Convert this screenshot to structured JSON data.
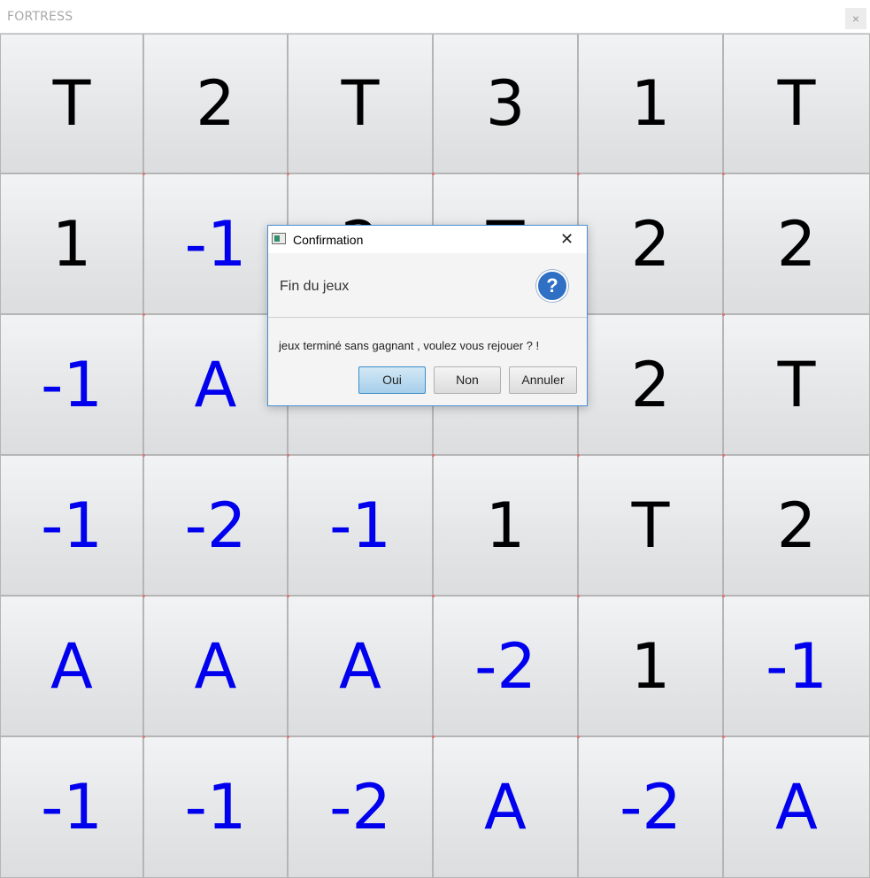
{
  "window": {
    "title": "FORTRESS",
    "close_glyph": "×"
  },
  "board": {
    "rows": [
      [
        {
          "v": "T",
          "team": "enemy"
        },
        {
          "v": "2",
          "team": "enemy"
        },
        {
          "v": "T",
          "team": "enemy"
        },
        {
          "v": "3",
          "team": "enemy"
        },
        {
          "v": "1",
          "team": "enemy"
        },
        {
          "v": "T",
          "team": "enemy"
        }
      ],
      [
        {
          "v": "1",
          "team": "enemy"
        },
        {
          "v": "-1",
          "team": "ally"
        },
        {
          "v": "2",
          "team": "enemy"
        },
        {
          "v": "T",
          "team": "enemy"
        },
        {
          "v": "2",
          "team": "enemy"
        },
        {
          "v": "2",
          "team": "enemy"
        }
      ],
      [
        {
          "v": "-1",
          "team": "ally"
        },
        {
          "v": "A",
          "team": "ally"
        },
        {
          "v": "",
          "team": "enemy"
        },
        {
          "v": "",
          "team": "enemy"
        },
        {
          "v": "2",
          "team": "enemy"
        },
        {
          "v": "T",
          "team": "enemy"
        }
      ],
      [
        {
          "v": "-1",
          "team": "ally"
        },
        {
          "v": "-2",
          "team": "ally"
        },
        {
          "v": "-1",
          "team": "ally"
        },
        {
          "v": "1",
          "team": "enemy"
        },
        {
          "v": "T",
          "team": "enemy"
        },
        {
          "v": "2",
          "team": "enemy"
        }
      ],
      [
        {
          "v": "A",
          "team": "ally"
        },
        {
          "v": "A",
          "team": "ally"
        },
        {
          "v": "A",
          "team": "ally"
        },
        {
          "v": "-2",
          "team": "ally"
        },
        {
          "v": "1",
          "team": "enemy"
        },
        {
          "v": "-1",
          "team": "ally"
        }
      ],
      [
        {
          "v": "-1",
          "team": "ally"
        },
        {
          "v": "-1",
          "team": "ally"
        },
        {
          "v": "-2",
          "team": "ally"
        },
        {
          "v": "A",
          "team": "ally"
        },
        {
          "v": "-2",
          "team": "ally"
        },
        {
          "v": "A",
          "team": "ally"
        }
      ]
    ],
    "colors": {
      "enemy": "#000000",
      "ally": "#0000ee"
    }
  },
  "dialog": {
    "title": "Confirmation",
    "close_glyph": "✕",
    "header_text": "Fin du jeux",
    "header_icon": "question-icon",
    "question_glyph": "?",
    "content_text": "jeux terminé sans gagnant , voulez vous rejouer ? !",
    "buttons": {
      "yes": "Oui",
      "no": "Non",
      "cancel": "Annuler"
    },
    "accent_color": "#4a8fd6"
  }
}
